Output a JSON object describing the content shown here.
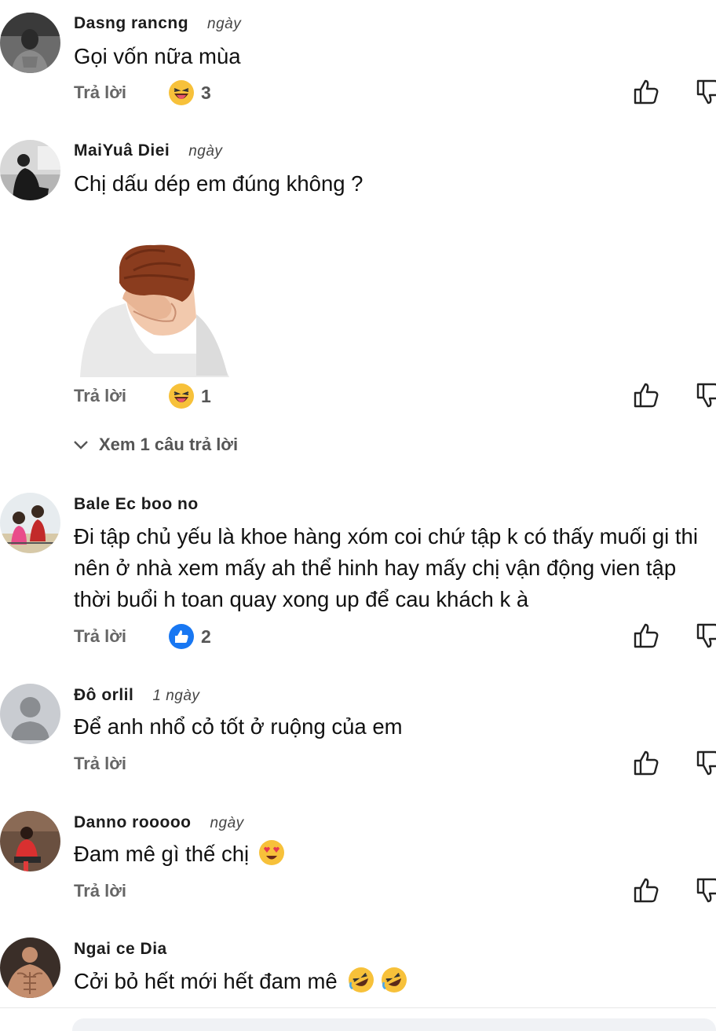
{
  "comments": [
    {
      "author": "Dasng rancng",
      "time": "ngày",
      "text": "Gọi vốn nữa mùa",
      "reply": "Trả lời",
      "reaction": "3"
    },
    {
      "author": "MaiYuâ Diei",
      "time": "ngày",
      "text": "Chị dấu dép em đúng không ?",
      "reply": "Trả lời",
      "reaction": "1",
      "view_replies": "Xem 1 câu trả lời"
    },
    {
      "author": "Bale Ec boo no",
      "time": "",
      "text": "Đi tập chủ yếu là khoe hàng xóm coi chứ tập k có thấy muối gi thi nên ở nhà xem mấy ah thể hinh hay mấy chị vận động vien tập thời buổi h toan quay xong up để cau khách k à",
      "reply": "Trả lời",
      "reaction": "2"
    },
    {
      "author": "Đô  orlil",
      "time": "1 ngày",
      "text": "Để anh  nhổ cỏ tốt  ở ruộng của em",
      "reply": "Trả lời",
      "reaction": ""
    },
    {
      "author": "Danno rooooo",
      "time": "ngày",
      "text": "Đam mê gì thế chị",
      "reply": "Trả lời",
      "reaction": ""
    },
    {
      "author": "Ngai ce Dia",
      "time": "",
      "text": "Cởi bỏ hết mới hết đam mê",
      "reply": "",
      "reaction": ""
    }
  ],
  "icons": {
    "like": "thumbs-up-outline-icon",
    "dislike": "thumbs-down-outline-icon",
    "haha": "laughing-emoji-icon",
    "like_reaction": "blue-like-icon",
    "heart_eyes": "heart-eyes-emoji-icon",
    "rofl": "rolling-laughing-emoji-icon",
    "chevron": "chevron-down-icon"
  },
  "colors": {
    "like_blue": "#1877f2",
    "emoji_yellow": "#f7c13a",
    "text_gray": "#666666"
  }
}
